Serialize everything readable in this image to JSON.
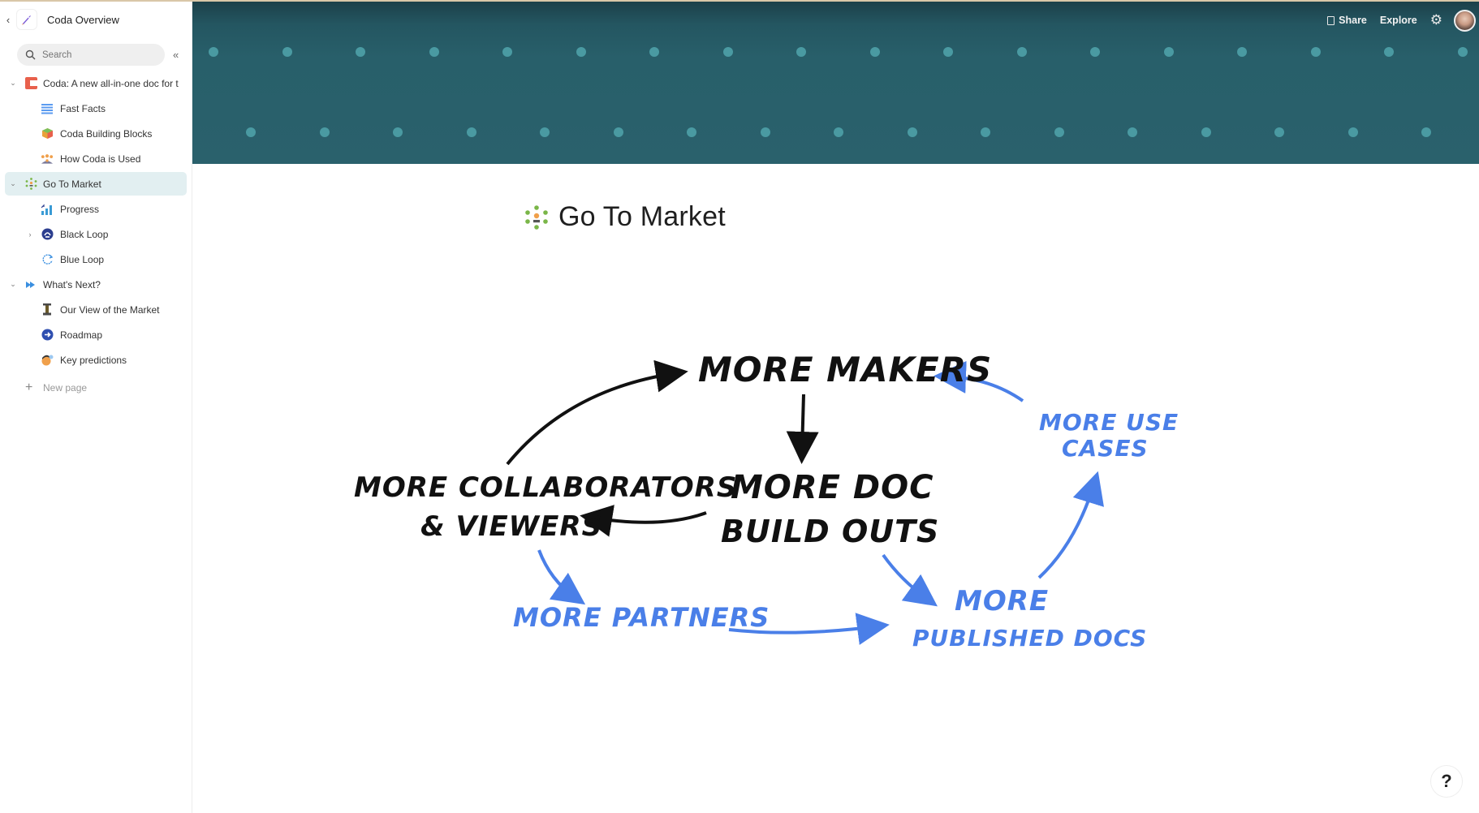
{
  "doc": {
    "title": "Coda Overview",
    "icon": "rocket-icon"
  },
  "search": {
    "placeholder": "Search"
  },
  "sidebar": {
    "items": [
      {
        "label": "Coda: A new all-in-one doc for t",
        "level": 0,
        "expanded": true,
        "icon": "coda-logo-icon",
        "icon_color": "#e8604c"
      },
      {
        "label": "Fast Facts",
        "level": 1,
        "icon": "list-icon",
        "icon_color": "#5b9bf0"
      },
      {
        "label": "Coda Building Blocks",
        "level": 1,
        "icon": "blocks-icon",
        "icon_color": "#e9a23b"
      },
      {
        "label": "How Coda is Used",
        "level": 1,
        "icon": "people-icon",
        "icon_color": "#f0a04b"
      },
      {
        "label": "Go To Market",
        "level": 0,
        "expanded": true,
        "selected": true,
        "icon": "team-dots-icon",
        "icon_color": "#7ab648"
      },
      {
        "label": "Progress",
        "level": 1,
        "icon": "bar-chart-icon",
        "icon_color": "#3a9bd5"
      },
      {
        "label": "Black Loop",
        "level": 1,
        "collapsed": true,
        "icon": "loop-icon",
        "icon_color": "#2c3e8f"
      },
      {
        "label": "Blue Loop",
        "level": 1,
        "icon": "refresh-icon",
        "icon_color": "#3a8fe0"
      },
      {
        "label": "What's Next?",
        "level": 0,
        "expanded": true,
        "icon": "fast-forward-icon",
        "icon_color": "#3a8fe0"
      },
      {
        "label": "Our View of the Market",
        "level": 1,
        "icon": "tower-icon",
        "icon_color": "#6b5a2a"
      },
      {
        "label": "Roadmap",
        "level": 1,
        "icon": "arrow-circle-icon",
        "icon_color": "#2f4fb0"
      },
      {
        "label": "Key predictions",
        "level": 1,
        "icon": "fortune-teller-icon",
        "icon_color": "#f0a04b"
      }
    ],
    "new_page_label": "New page"
  },
  "header": {
    "share_label": "Share",
    "explore_label": "Explore"
  },
  "page": {
    "title": "Go To Market"
  },
  "diagram": {
    "black_color": "#111111",
    "blue_color": "#4a7fe8",
    "nodes": {
      "makers": "More Makers",
      "collaborators_1": "More collaborators",
      "collaborators_2": "& viewers",
      "doc_1": "More Doc",
      "doc_2": "Build outs",
      "use_cases_1": "More use",
      "use_cases_2": "cases",
      "partners": "More Partners",
      "published_1": "More",
      "published_2": "Published Docs"
    }
  },
  "help": {
    "label": "?"
  }
}
